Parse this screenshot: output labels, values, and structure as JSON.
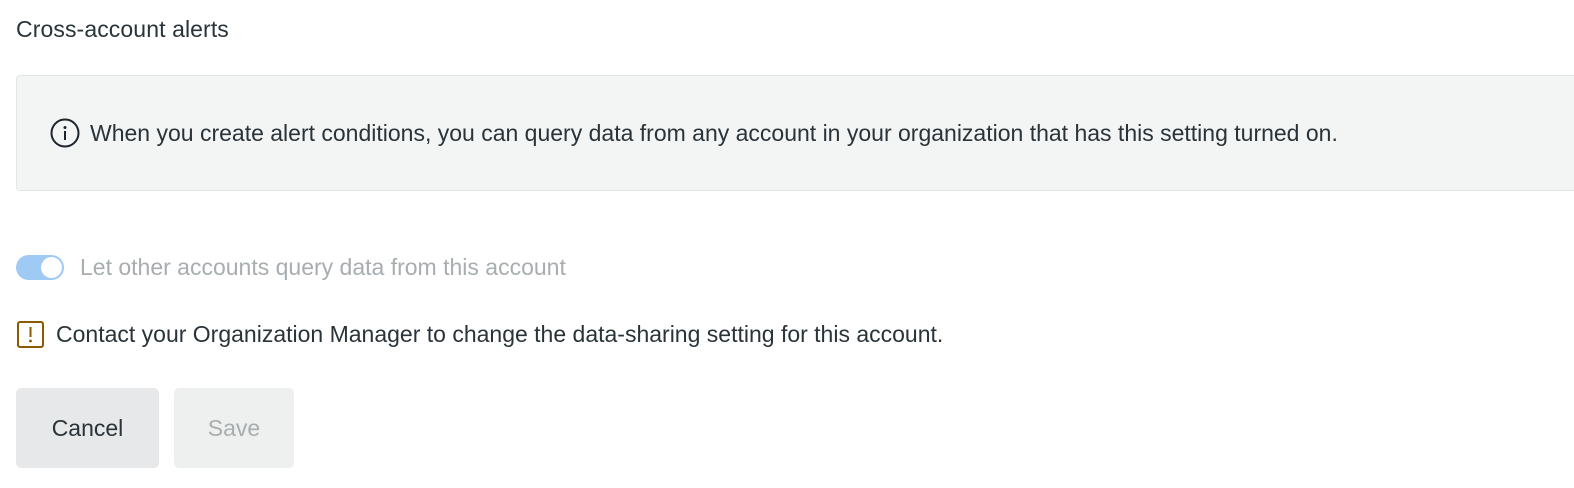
{
  "section": {
    "title": "Cross-account alerts"
  },
  "info_banner": {
    "icon": "info-circle-icon",
    "text": "When you create alert conditions, you can query data from any account in your organization that has this setting turned on."
  },
  "data_sharing_toggle": {
    "state": "on",
    "disabled": true,
    "label": "Let other accounts query data from this account"
  },
  "warning": {
    "icon": "warning-square-icon",
    "text": "Contact your Organization Manager to change the data-sharing setting for this account."
  },
  "actions": {
    "cancel_label": "Cancel",
    "save_label": "Save",
    "save_disabled": true
  },
  "colors": {
    "toggle_track": "#9fcaf3",
    "warning_icon": "#8a5a00",
    "banner_background": "#f3f4f4"
  }
}
